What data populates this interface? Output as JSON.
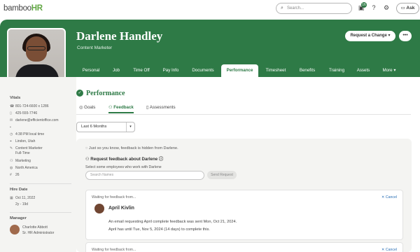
{
  "app": {
    "logo_prefix": "bamboo",
    "logo_suffix": "HR"
  },
  "topbar": {
    "search_placeholder": "Search...",
    "notification_count": "16",
    "ask_label": "Ask"
  },
  "colors": {
    "brand": "#2e7a46",
    "link": "#2a6fb5",
    "panel": "#f4f4f2"
  },
  "profile": {
    "name": "Darlene Handley",
    "title": "Content Marketer",
    "request_change_label": "Request a Change",
    "more_menu": "•••"
  },
  "tabs": [
    "Personal",
    "Job",
    "Time Off",
    "Pay Info",
    "Documents",
    "Performance",
    "Timesheet",
    "Benefits",
    "Training",
    "Assets",
    "More"
  ],
  "active_tab": "Performance",
  "sidebar": {
    "vitals_heading": "Vitals",
    "work_phone": "801-724-6600 x 1286",
    "mobile_phone": "425-555-7746",
    "email": "darlene@efficientoffice.com",
    "local_time": "4:38 PM local time",
    "location": "Lindon, Utah",
    "job_title": "Content Marketer",
    "employment_type": "Full-Time",
    "department": "Marketing",
    "region": "North America",
    "employee_number": "26",
    "hire_heading": "Hire Date",
    "hire_date": "Oct 11, 2022",
    "tenure": "2y - 19d",
    "manager_heading": "Manager",
    "manager_name": "Charlotte Abbott",
    "manager_title": "Sr. HR Administrator"
  },
  "page": {
    "title": "Performance",
    "subtabs": [
      "Goals",
      "Feedback",
      "Assessments"
    ],
    "active_subtab": "Feedback",
    "filter_value": "Last 6 Months",
    "hidden_note": "Just so you know, feedback is hidden from Darlene.",
    "request_title": "Request feedback about Darlene",
    "request_subtitle": "Select some employees who work with Darlene",
    "request_placeholder": "Search Names",
    "send_label": "Send Request"
  },
  "feedback_cards": [
    {
      "waiting": "Waiting for feedback from...",
      "cancel": "Cancel",
      "person": "April Kivlin",
      "line1": "An email requesting April complete feedback was sent Mon, Oct 21, 2024.",
      "line2": "April has until Tue, Nov 5, 2024 (14 days) to complete this."
    },
    {
      "waiting": "Waiting for feedback from...",
      "cancel": "Cancel"
    }
  ]
}
